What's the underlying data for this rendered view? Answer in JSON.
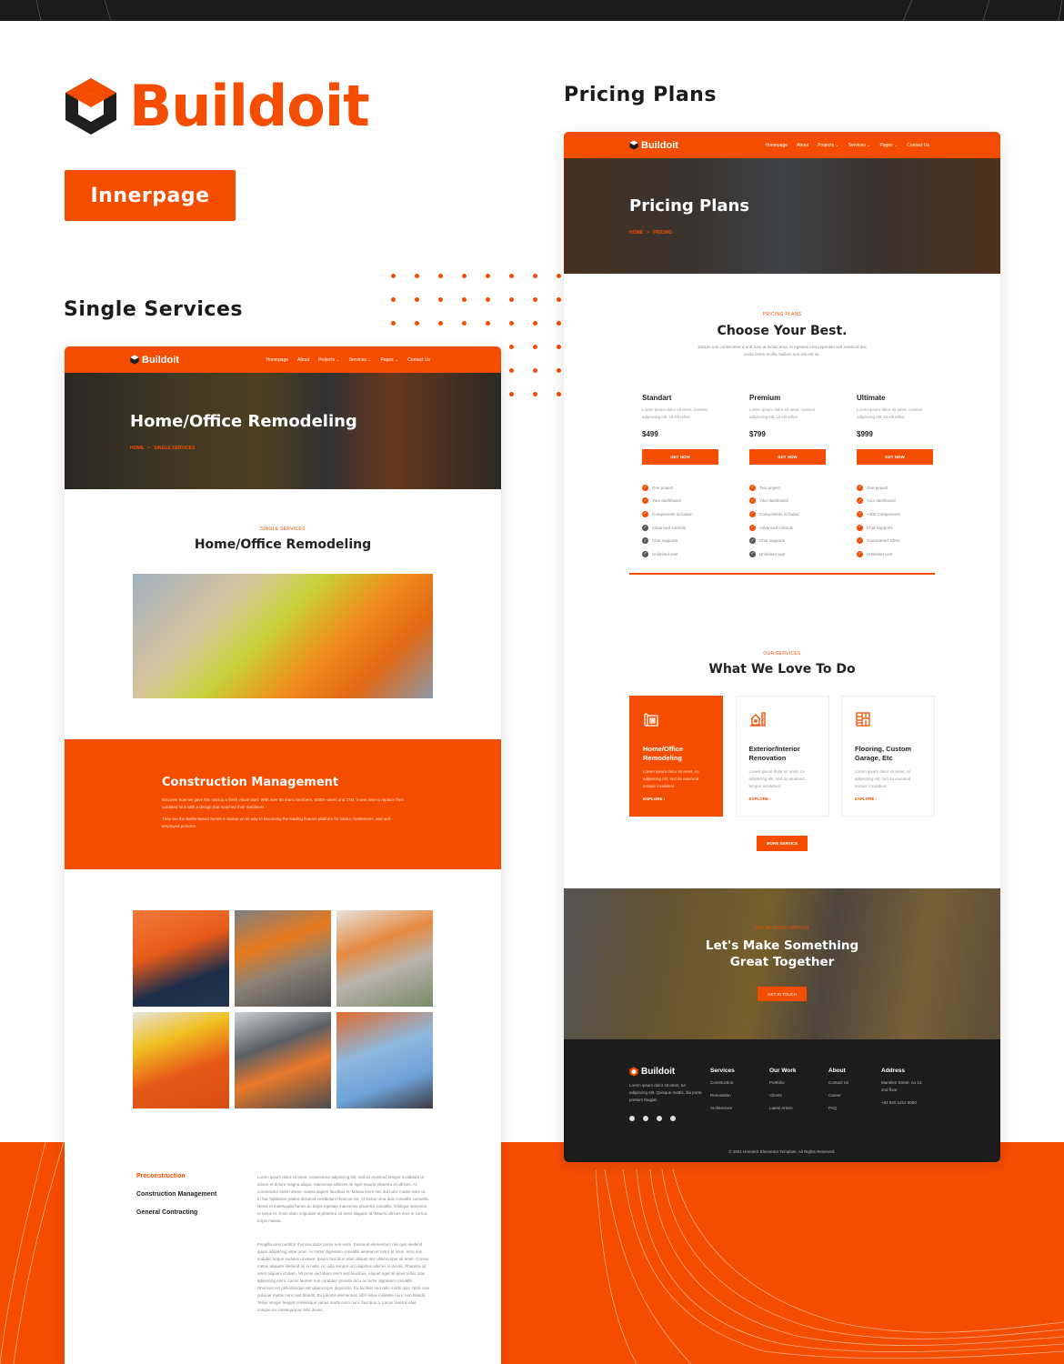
{
  "brand": {
    "name": "Buildoit",
    "accent_color": "#f54d00",
    "dark_color": "#1b1b1b"
  },
  "badge": {
    "label": "Innerpage"
  },
  "sections": {
    "single_services_label": "Single Services",
    "pricing_plans_label": "Pricing Plans"
  },
  "nav": {
    "logo": "Buildoit",
    "links": [
      "Homepage",
      "About",
      "Projects ⌄",
      "Services ⌄",
      "Pages ⌄",
      "Contact Us"
    ]
  },
  "single_services": {
    "hero_title": "Home/Office Remodeling",
    "breadcrumb_home": "HOME",
    "breadcrumb_sep": ">",
    "breadcrumb_current": "SINGLE SERVICES",
    "eyebrow": "SINGLE SERVICES",
    "title": "Home/Office Remodeling",
    "cm_title": "Construction Management",
    "cm_para1": "Discover how we gave this startup a fresh visual start. With over 50 team members, 5000+ users and 27M, it was time to replace their outdated look with a design that matched their ambitions.",
    "cm_para2": "They are the Berlin-based Series A startup on its way to becoming the leading finance platform for SMEs, freelancers, and self-employed persons.",
    "tabs": [
      "Preconstruction",
      "Construction Management",
      "General Contracting"
    ],
    "tab_para1": "Lorem ipsum dolor sit amet, consectetur adipiscing elit, sed do eiusmod tempor incididunt ut labore et dolore magna aliqua. Maecenas ultricies mi eget mauris pharetra et ultrices. At consectetur lorem donec massa sapien faucibus et. Massa enim nec dui nunc mattis enim ut. In hac habitasse platea dictumst vestibulum rhoncus est. At lectus urna duis convallis convallis. Netus et malesuada fames ac turpis egestas maecenas pharetra convallis. Tristique senectus et netus et. Enim diam vulputate ut pharetra sit amet aliquam id. Mauris ultrices eros in cursus turpis massa.",
    "tab_para2": "Fringilla urna porttitor rhoncus dolor purus non enim. Euismod elementum nisi quis eleifend quam adipiscing vitae proin. Ac tortor dignissim convallis aenean et tortor at risus. Arcu non sodales neque sodales ut etiam. Ipsum faucibus vitae aliquet nec ullamcorper sit amet. Cursus metus aliquam eleifend mi in nulla. Ac odio tempor orci dapibus ultrices in iaculis. Pharetra sit amet aliquam id diam. Mi proin sed libero enim sed faucibus. Aliquet eget sit amet tellus cras adipiscing enim. Lacus laoreet non curabitur gravida arcu ac tortor dignissim convallis. Rhoncus est pellentesque elit ullamcorper dignissim. Eu facilisis sed odio morbi quis. Nibh cras pulvinar mattis nunc sed blandit. Eu lobortis elementum nibh tellus molestie nunc non blandit. Tellus integer feugiat scelerisque varius morbi enim nunc faucibus a. Lacus viverra vitae congue eu consequat ac felis donec."
  },
  "pricing": {
    "hero_title": "Pricing Plans",
    "breadcrumb_home": "HOME",
    "breadcrumb_sep": ">",
    "breadcrumb_current": "PRICING",
    "eyebrow": "PRICING PLANS",
    "title": "Choose Your Best.",
    "subtitle": "Dictum non consectetur a erat nam at lectus urna. In egestas erat imperdiet sed euismod nisi porta lorem mollis. Nullam non nisi est sit.",
    "plans": [
      {
        "name": "Standart",
        "desc": "Lorem ipsum dolor sit amet, consect adipiscing elit. Ut elit tellus",
        "price": "$499",
        "button": "GET NOW",
        "features": [
          {
            "label": "One project",
            "included": true
          },
          {
            "label": "Your dashboard",
            "included": true
          },
          {
            "label": "Components included",
            "included": true
          },
          {
            "label": "Advanced controls",
            "included": false
          },
          {
            "label": "Chat supports",
            "included": false
          },
          {
            "label": "Unlimited user",
            "included": false
          }
        ]
      },
      {
        "name": "Premium",
        "desc": "Lorem ipsum dolor sit amet, consect adipiscing elit. Ut elit tellus",
        "price": "$799",
        "button": "GET NOW",
        "features": [
          {
            "label": "Two project",
            "included": true
          },
          {
            "label": "Your dashboard",
            "included": true
          },
          {
            "label": "Components included",
            "included": true
          },
          {
            "label": "Advanced controls",
            "included": true
          },
          {
            "label": "Chat supports",
            "included": false
          },
          {
            "label": "Unlimited user",
            "included": false
          }
        ]
      },
      {
        "name": "Ultimate",
        "desc": "Lorem ipsum dolor sit amet, consect adipiscing elit. Ut elit tellus",
        "price": "$999",
        "button": "GET NOW",
        "features": [
          {
            "label": "One project",
            "included": true
          },
          {
            "label": "Your dashboard",
            "included": true
          },
          {
            "label": "+300 Components",
            "included": true
          },
          {
            "label": "Chat Supports",
            "included": true
          },
          {
            "label": "Guaranteed 100%",
            "included": true
          },
          {
            "label": "Unlimited user",
            "included": true
          }
        ]
      }
    ],
    "services_eyebrow": "OUR SERVICES",
    "services_title": "What We Love To Do",
    "services": [
      {
        "title": "Home/Office Remodeling",
        "desc": "Lorem ipsum dolor sit amet, co adipiscing elit, sed do eiusmod tempor incididunt.",
        "link": "EXPLORE ›",
        "icon": "blueprint-icon",
        "active": true
      },
      {
        "title": "Exterior/Interior Renovation",
        "desc": "Lorem ipsum dolor sit amet, co adipiscing elit, sed do eiusmod tempor incididunt.",
        "link": "EXPLORE ›",
        "icon": "house-ruler-icon",
        "active": false
      },
      {
        "title": "Flooring, Custom Garage, Etc",
        "desc": "Lorem ipsum dolor sit amet, co adipiscing elit, sed do eiusmod tempor incididunt.",
        "link": "EXPLORE ›",
        "icon": "parquet-icon",
        "active": false
      }
    ],
    "more_service": "MORE SERVICE",
    "cta_eyebrow": "GET IN TOUCH WITH US",
    "cta_title_line1": "Let's Make Something",
    "cta_title_line2": "Great Together",
    "cta_button": "GET IN TOUCH",
    "footer": {
      "logo": "Buildoit",
      "about": "Lorem ipsum dolor sit amet, tur adipiscing elit. Quisque mattis, dui porta pretium feugiat.",
      "columns": [
        {
          "title": "Services",
          "items": [
            "Construction",
            "Renovation",
            "Architecture"
          ]
        },
        {
          "title": "Our Work",
          "items": [
            "Portfolio",
            "Clients",
            "Latest Article"
          ]
        },
        {
          "title": "About",
          "items": [
            "Contact Us",
            "Career",
            "FAQ"
          ]
        },
        {
          "title": "Address",
          "items": [
            "Marolien Street, no 14, 2nd floor",
            "+62 820 1212 5050"
          ]
        }
      ],
      "social": [
        "facebook-icon",
        "twitter-icon",
        "youtube-icon",
        "linkedin-icon"
      ],
      "copyright": "© 2021 HomeKit Elementor Template. All Rights Reserved."
    }
  }
}
